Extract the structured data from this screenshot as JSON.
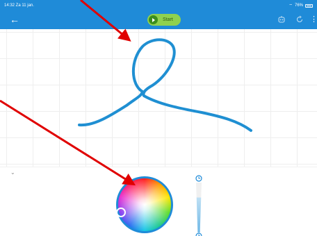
{
  "status_bar": {
    "time": "14:32 Za 11 jan.",
    "battery": "76%"
  },
  "toolbar": {
    "start_label": "Start",
    "icons": [
      "back-arrow-icon",
      "play-icon",
      "robot-icon",
      "reset-icon",
      "more-vert-icon"
    ]
  },
  "drawing": {
    "stroke_color": "#1f8fd2"
  },
  "annotations": {
    "arrow_color": "#e00000"
  },
  "color_picker": {
    "ring_color": "#1f8bd8"
  },
  "accent_color": "#1f8bd8"
}
